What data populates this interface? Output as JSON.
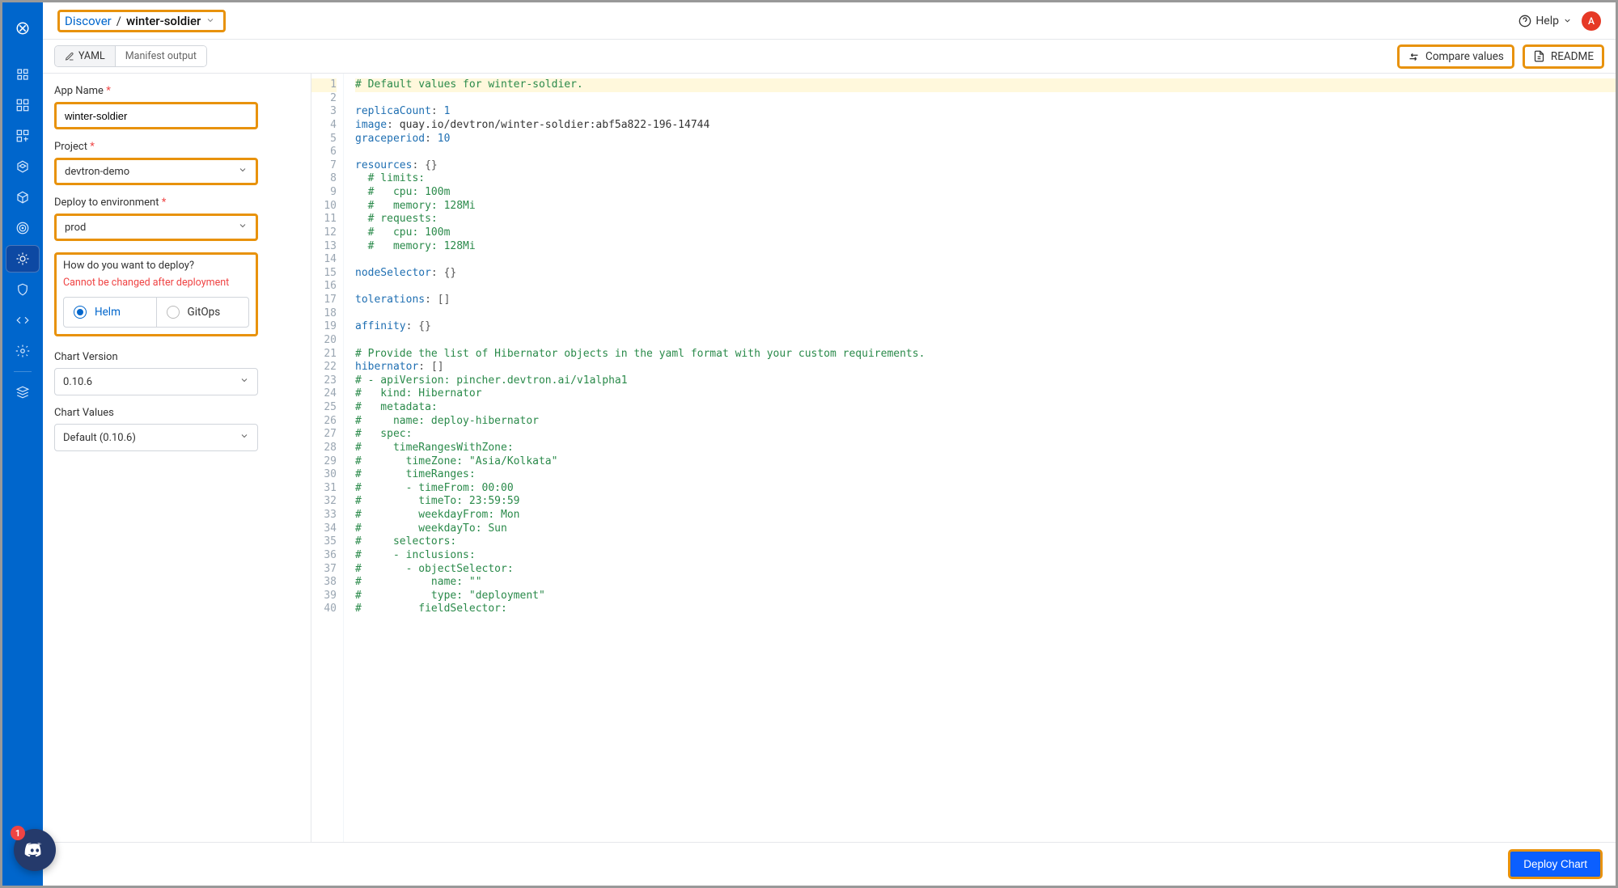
{
  "sidebar": {
    "discord_badge": "1"
  },
  "header": {
    "breadcrumb_root": "Discover",
    "breadcrumb_current": "winter-soldier",
    "help": "Help",
    "avatar": "A"
  },
  "toolbar": {
    "tab_yaml": "YAML",
    "tab_manifest": "Manifest output",
    "compare": "Compare values",
    "readme": "README"
  },
  "form": {
    "app_name_label": "App Name",
    "app_name_value": "winter-soldier",
    "project_label": "Project",
    "project_value": "devtron-demo",
    "env_label": "Deploy to environment",
    "env_value": "prod",
    "how_label": "How do you want to deploy?",
    "how_warn": "Cannot be changed after deployment",
    "opt_helm": "Helm",
    "opt_gitops": "GitOps",
    "chart_version_label": "Chart Version",
    "chart_version_value": "0.10.6",
    "chart_values_label": "Chart Values",
    "chart_values_value": "Default (0.10.6)"
  },
  "footer": {
    "deploy": "Deploy Chart"
  },
  "code": [
    {
      "n": 1,
      "hl": true,
      "t": [
        [
          "com",
          "# Default values for winter-soldier."
        ]
      ]
    },
    {
      "n": 2,
      "t": []
    },
    {
      "n": 3,
      "t": [
        [
          "key",
          "replicaCount"
        ],
        [
          "punct",
          ": "
        ],
        [
          "num",
          "1"
        ]
      ]
    },
    {
      "n": 4,
      "t": [
        [
          "key",
          "image"
        ],
        [
          "punct",
          ": "
        ],
        [
          "plain",
          "quay.io/devtron/winter-soldier:abf5a822-196-14744"
        ]
      ]
    },
    {
      "n": 5,
      "t": [
        [
          "key",
          "graceperiod"
        ],
        [
          "punct",
          ": "
        ],
        [
          "num",
          "10"
        ]
      ]
    },
    {
      "n": 6,
      "t": []
    },
    {
      "n": 7,
      "t": [
        [
          "key",
          "resources"
        ],
        [
          "punct",
          ": "
        ],
        [
          "punct",
          "{}"
        ]
      ]
    },
    {
      "n": 8,
      "t": [
        [
          "plain",
          "  "
        ],
        [
          "com",
          "# limits:"
        ]
      ]
    },
    {
      "n": 9,
      "t": [
        [
          "plain",
          "  "
        ],
        [
          "com",
          "#   cpu: 100m"
        ]
      ]
    },
    {
      "n": 10,
      "t": [
        [
          "plain",
          "  "
        ],
        [
          "com",
          "#   memory: 128Mi"
        ]
      ]
    },
    {
      "n": 11,
      "t": [
        [
          "plain",
          "  "
        ],
        [
          "com",
          "# requests:"
        ]
      ]
    },
    {
      "n": 12,
      "t": [
        [
          "plain",
          "  "
        ],
        [
          "com",
          "#   cpu: 100m"
        ]
      ]
    },
    {
      "n": 13,
      "t": [
        [
          "plain",
          "  "
        ],
        [
          "com",
          "#   memory: 128Mi"
        ]
      ]
    },
    {
      "n": 14,
      "t": []
    },
    {
      "n": 15,
      "t": [
        [
          "key",
          "nodeSelector"
        ],
        [
          "punct",
          ": "
        ],
        [
          "punct",
          "{}"
        ]
      ]
    },
    {
      "n": 16,
      "t": []
    },
    {
      "n": 17,
      "t": [
        [
          "key",
          "tolerations"
        ],
        [
          "punct",
          ": "
        ],
        [
          "punct",
          "[]"
        ]
      ]
    },
    {
      "n": 18,
      "t": []
    },
    {
      "n": 19,
      "t": [
        [
          "key",
          "affinity"
        ],
        [
          "punct",
          ": "
        ],
        [
          "punct",
          "{}"
        ]
      ]
    },
    {
      "n": 20,
      "t": []
    },
    {
      "n": 21,
      "t": [
        [
          "com",
          "# Provide the list of Hibernator objects in the yaml format with your custom requirements."
        ]
      ]
    },
    {
      "n": 22,
      "t": [
        [
          "key",
          "hibernator"
        ],
        [
          "punct",
          ": "
        ],
        [
          "punct",
          "[]"
        ]
      ]
    },
    {
      "n": 23,
      "t": [
        [
          "com",
          "# - apiVersion: pincher.devtron.ai/v1alpha1"
        ]
      ]
    },
    {
      "n": 24,
      "t": [
        [
          "com",
          "#   kind: Hibernator"
        ]
      ]
    },
    {
      "n": 25,
      "t": [
        [
          "com",
          "#   metadata:"
        ]
      ]
    },
    {
      "n": 26,
      "t": [
        [
          "com",
          "#     name: deploy-hibernator"
        ]
      ]
    },
    {
      "n": 27,
      "t": [
        [
          "com",
          "#   spec:"
        ]
      ]
    },
    {
      "n": 28,
      "t": [
        [
          "com",
          "#     timeRangesWithZone:"
        ]
      ]
    },
    {
      "n": 29,
      "t": [
        [
          "com",
          "#       timeZone: \"Asia/Kolkata\""
        ]
      ]
    },
    {
      "n": 30,
      "t": [
        [
          "com",
          "#       timeRanges:"
        ]
      ]
    },
    {
      "n": 31,
      "t": [
        [
          "com",
          "#       - timeFrom: 00:00"
        ]
      ]
    },
    {
      "n": 32,
      "t": [
        [
          "com",
          "#         timeTo: 23:59:59"
        ]
      ]
    },
    {
      "n": 33,
      "t": [
        [
          "com",
          "#         weekdayFrom: Mon"
        ]
      ]
    },
    {
      "n": 34,
      "t": [
        [
          "com",
          "#         weekdayTo: Sun"
        ]
      ]
    },
    {
      "n": 35,
      "t": [
        [
          "com",
          "#     selectors:"
        ]
      ]
    },
    {
      "n": 36,
      "t": [
        [
          "com",
          "#     - inclusions:"
        ]
      ]
    },
    {
      "n": 37,
      "t": [
        [
          "com",
          "#       - objectSelector:"
        ]
      ]
    },
    {
      "n": 38,
      "t": [
        [
          "com",
          "#           name: \"\""
        ]
      ]
    },
    {
      "n": 39,
      "t": [
        [
          "com",
          "#           type: \"deployment\""
        ]
      ]
    },
    {
      "n": 40,
      "t": [
        [
          "com",
          "#         fieldSelector:"
        ]
      ]
    }
  ]
}
